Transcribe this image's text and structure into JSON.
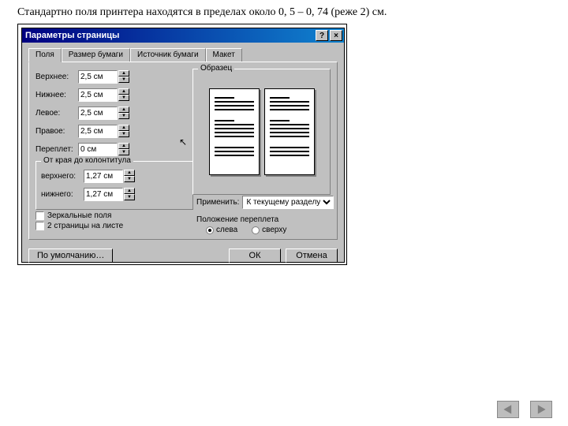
{
  "caption": "Стандартно поля принтера находятся в пределах около 0, 5 – 0, 74 (реже 2) см.",
  "window": {
    "title": "Параметры страницы",
    "help": "?",
    "close": "×"
  },
  "tabs": [
    "Поля",
    "Размер бумаги",
    "Источник бумаги",
    "Макет"
  ],
  "fields": {
    "top": {
      "label": "Верхнее:",
      "value": "2,5 см"
    },
    "bottom": {
      "label": "Нижнее:",
      "value": "2,5 см"
    },
    "left": {
      "label": "Левое:",
      "value": "2,5 см"
    },
    "right": {
      "label": "Правое:",
      "value": "2,5 см"
    },
    "gutter": {
      "label": "Переплет:",
      "value": "0 см"
    }
  },
  "header_footer": {
    "title": "От края до колонтитула",
    "header": {
      "label": "верхнего:",
      "value": "1,27 см"
    },
    "footer": {
      "label": "нижнего:",
      "value": "1,27 см"
    }
  },
  "checks": {
    "mirror": "Зеркальные поля",
    "two_pages": "2 страницы на листе"
  },
  "preview_title": "Образец",
  "apply": {
    "label": "Применить:",
    "value": "К текущему разделу"
  },
  "binding": {
    "title": "Положение переплета",
    "left": "слева",
    "top": "сверху"
  },
  "buttons": {
    "default": "По умолчанию…",
    "ok": "ОК",
    "cancel": "Отмена"
  }
}
